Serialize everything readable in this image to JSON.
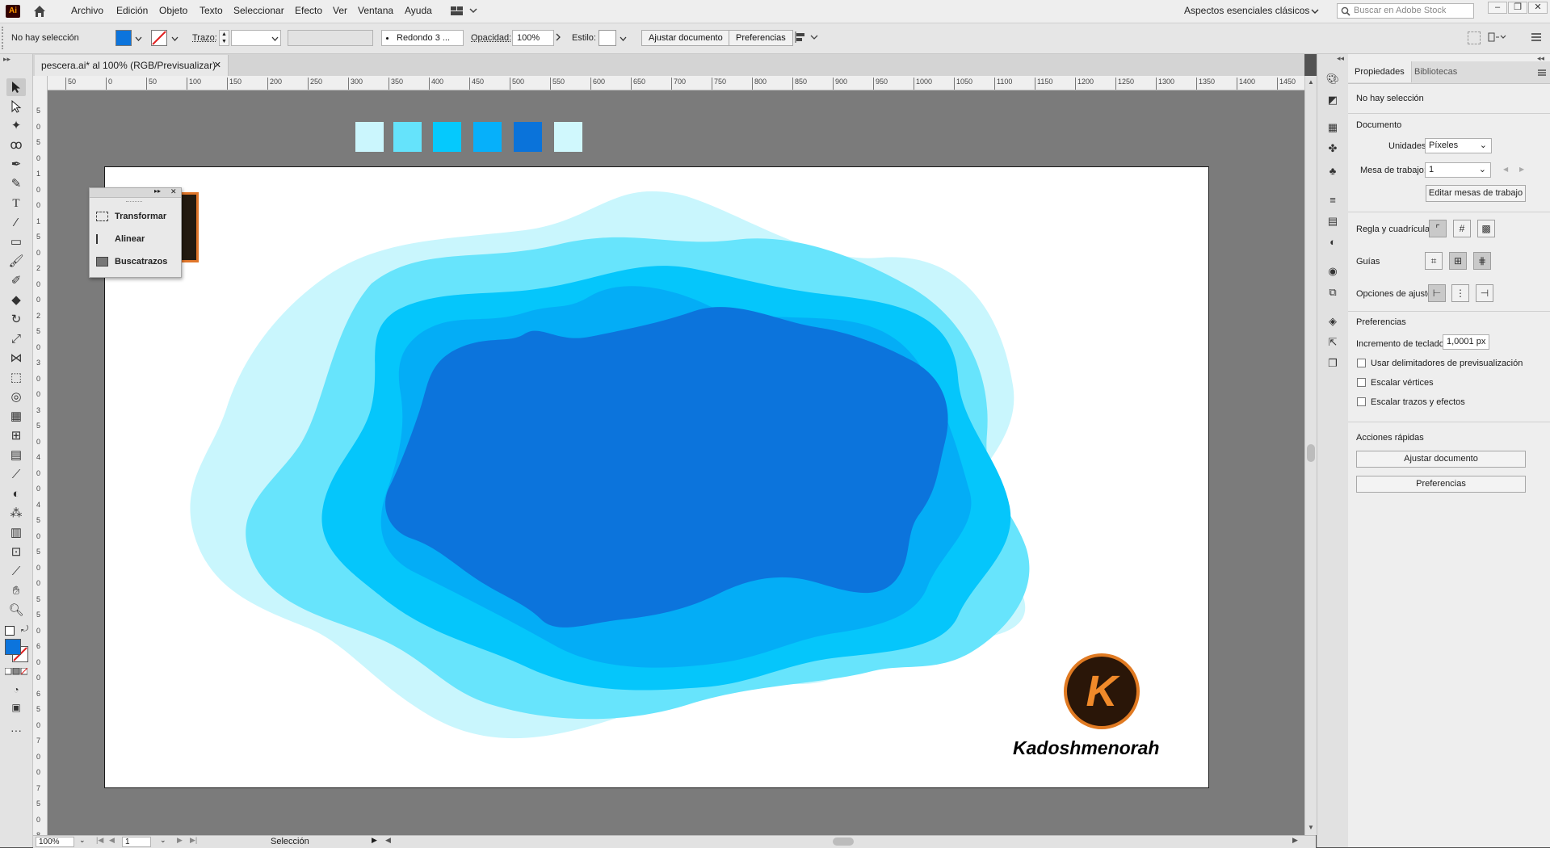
{
  "menubar": {
    "app_logo": "Ai",
    "items": [
      "Archivo",
      "Edición",
      "Objeto",
      "Texto",
      "Seleccionar",
      "Efecto",
      "Ver",
      "Ventana",
      "Ayuda"
    ],
    "workspace": "Aspectos esenciales clásicos",
    "search_placeholder": "Buscar en Adobe Stock"
  },
  "controlbar": {
    "selection_status": "No hay selección",
    "stroke_label": "Trazo:",
    "brush_value": "Redondo 3 ...",
    "opacity_label": "Opacidad:",
    "opacity_value": "100%",
    "style_label": "Estilo:",
    "fit_document_button": "Ajustar documento",
    "preferences_button": "Preferencias"
  },
  "document": {
    "tab_title": "pescera.ai* al 100% (RGB/Previsualizar)"
  },
  "ruler": {
    "h_ticks": [
      "50",
      "0",
      "50",
      "100",
      "150",
      "200",
      "250",
      "300",
      "350",
      "400",
      "450",
      "500",
      "550",
      "600",
      "650",
      "700",
      "750",
      "800",
      "850",
      "900",
      "950",
      "1000",
      "1050",
      "1100",
      "1150",
      "1200",
      "1250",
      "1300",
      "1350",
      "1400",
      "1450"
    ],
    "v_ticks": [
      "5",
      "0",
      "5",
      "0",
      "1",
      "0",
      "0",
      "1",
      "5",
      "0",
      "2",
      "0",
      "0",
      "2",
      "5",
      "0",
      "3",
      "0",
      "0",
      "3",
      "5",
      "0",
      "4",
      "0",
      "0",
      "4",
      "5",
      "0",
      "5",
      "0",
      "0",
      "5",
      "5",
      "0",
      "6",
      "0",
      "0",
      "6",
      "5",
      "0",
      "7",
      "0",
      "0",
      "7",
      "5",
      "0",
      "8",
      "0"
    ]
  },
  "swatches": [
    "#cbf6fd",
    "#65e3fb",
    "#05c9fd",
    "#06b0fa",
    "#0a73da",
    "#d0f8fd"
  ],
  "artwork": {
    "colors": {
      "layer1": "#c9f6fd",
      "layer2": "#67e4fc",
      "layer3": "#05c6fb",
      "layer4": "#04adf6",
      "layer5": "#0c74dc"
    },
    "watermark_letter": "K",
    "watermark_text": "Kadoshmenorah"
  },
  "floating_panel": {
    "items": [
      "Transformar",
      "Alinear",
      "Buscatrazos"
    ]
  },
  "statusbar": {
    "zoom": "100%",
    "artboard_num": "1",
    "tool": "Selección"
  },
  "properties": {
    "tab_properties": "Propiedades",
    "tab_libraries": "Bibliotecas",
    "no_selection": "No hay selección",
    "document_heading": "Documento",
    "units_label": "Unidades:",
    "units_value": "Píxeles",
    "artboard_label": "Mesa de trabajo:",
    "artboard_value": "1",
    "edit_artboards_button": "Editar mesas de trabajo",
    "rulers_grids_label": "Regla y cuadrículas",
    "guides_label": "Guías",
    "snap_options_label": "Opciones de ajuste",
    "preferences_heading": "Preferencias",
    "keyboard_increment_label": "Incremento de teclado:",
    "keyboard_increment_value": "1,0001 px",
    "chk_preview_bounds": "Usar delimitadores de previsualización",
    "chk_scale_corners": "Escalar vértices",
    "chk_scale_strokes": "Escalar trazos y efectos",
    "quick_actions_heading": "Acciones rápidas",
    "qa_fit_document": "Ajustar documento",
    "qa_preferences": "Preferencias"
  }
}
